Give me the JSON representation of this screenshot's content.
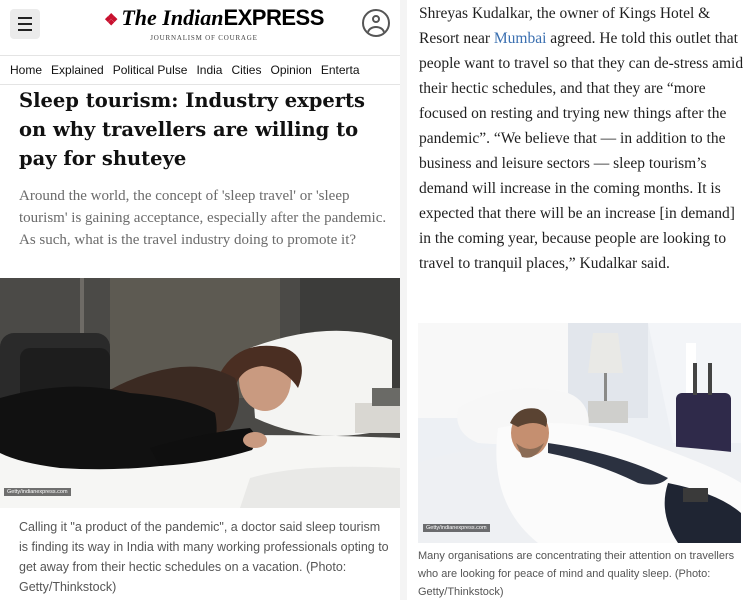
{
  "header": {
    "logo_main": "The Indian",
    "logo_express": "EXPRESS",
    "logo_tagline": "JOURNALISM OF COURAGE"
  },
  "nav": {
    "items": [
      "Home",
      "Explained",
      "Political Pulse",
      "India",
      "Cities",
      "Opinion",
      "Enterta"
    ]
  },
  "article": {
    "headline": "Sleep tourism: Industry experts on why travellers are willing to pay for shuteye",
    "synopsis": "Around the world, the concept of 'sleep travel' or 'sleep tourism' is gaining acceptance, especially after the pandemic. As such, what is the travel industry doing to promote it?",
    "image1_credit": "Getty/indianexpress.com",
    "caption1": "Calling it \"a product of the pandemic\", a doctor said sleep tourism is finding its way in India with many working professionals opting to get away from their hectic schedules on a vacation. (Photo: Getty/Thinkstock)",
    "paragraph_before_link": "Shreyas Kudalkar, the owner of Kings Hotel & Resort near ",
    "paragraph_link": "Mumbai",
    "paragraph_after_link": " agreed. He told this outlet that people want to travel so that they can de-stress amid their hectic schedules, and that they are “more focused on resting and trying new things after the pandemic”. “We believe that — in addition to the business and leisure sectors — sleep tourism’s demand will increase in the coming months. It is expected that there will be an increase [in demand] in the coming year, because people are looking to travel to tranquil places,” Kudalkar said.",
    "image2_credit": "Getty/indianexpress.com",
    "caption2": "Many organisations are concentrating their attention on travellers who are looking for peace of mind and quality sleep. (Photo: Getty/Thinkstock)"
  },
  "icons": {
    "menu": "hamburger-menu-icon",
    "account": "user-account-icon"
  }
}
